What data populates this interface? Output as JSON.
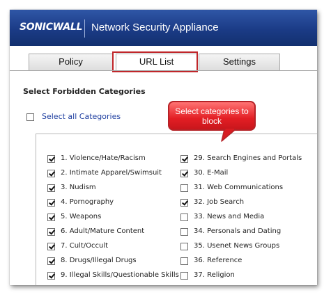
{
  "header": {
    "logo_text": "SONICWALL",
    "app_title": "Network Security Appliance",
    "brand_color": "#1b3b86"
  },
  "tabs": [
    {
      "label": "Policy"
    },
    {
      "label": "URL List",
      "active": true,
      "highlighted": true
    },
    {
      "label": "Settings"
    }
  ],
  "section_title": "Select Forbidden Categories",
  "select_all": {
    "label": "Select all Categories",
    "checked": false
  },
  "callout": {
    "text": "Select categories to block",
    "color": "#e31e24"
  },
  "categories_left": [
    {
      "label": "1. Violence/Hate/Racism",
      "checked": true
    },
    {
      "label": "2. Intimate Apparel/Swimsuit",
      "checked": true
    },
    {
      "label": "3. Nudism",
      "checked": true
    },
    {
      "label": "4. Pornography",
      "checked": true
    },
    {
      "label": "5. Weapons",
      "checked": true
    },
    {
      "label": "6. Adult/Mature Content",
      "checked": true
    },
    {
      "label": "7. Cult/Occult",
      "checked": true
    },
    {
      "label": "8. Drugs/Illegal Drugs",
      "checked": true
    },
    {
      "label": "9. Illegal Skills/Questionable Skills",
      "checked": true
    }
  ],
  "categories_right": [
    {
      "label": "29. Search Engines and Portals",
      "checked": true
    },
    {
      "label": "30. E-Mail",
      "checked": true
    },
    {
      "label": "31. Web Communications",
      "checked": false
    },
    {
      "label": "32. Job Search",
      "checked": true
    },
    {
      "label": "33. News and Media",
      "checked": false
    },
    {
      "label": "34. Personals and Dating",
      "checked": false
    },
    {
      "label": "35. Usenet News Groups",
      "checked": false
    },
    {
      "label": "36. Reference",
      "checked": false
    },
    {
      "label": "37. Religion",
      "checked": false
    }
  ]
}
